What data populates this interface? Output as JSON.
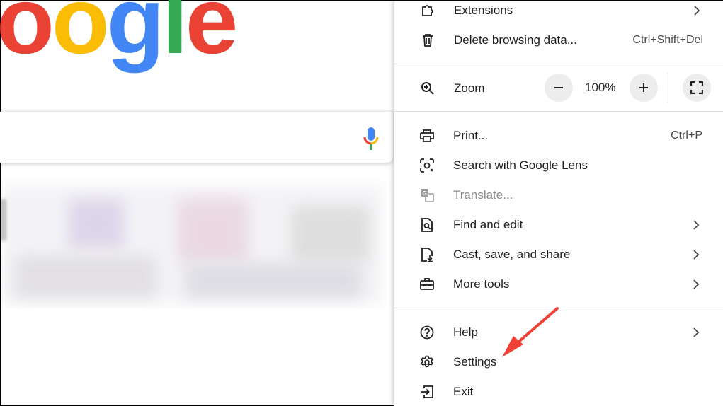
{
  "logo": {
    "letters": [
      "o",
      "o",
      "g",
      "l",
      "e"
    ],
    "colors": [
      "#EA4335",
      "#FBBC05",
      "#4285F4",
      "#34A853",
      "#EA4335"
    ]
  },
  "search": {
    "mic_icon": "microphone-icon"
  },
  "menu": {
    "extensions": {
      "label": "Extensions",
      "icon": "puzzle-icon"
    },
    "delete_browsing": {
      "label": "Delete browsing data...",
      "shortcut": "Ctrl+Shift+Del",
      "icon": "trash-icon"
    },
    "zoom": {
      "label": "Zoom",
      "value": "100%",
      "minus": "−",
      "plus": "+",
      "icon": "zoom-in-icon"
    },
    "print": {
      "label": "Print...",
      "shortcut": "Ctrl+P",
      "icon": "printer-icon"
    },
    "lens": {
      "label": "Search with Google Lens",
      "icon": "lens-icon"
    },
    "translate": {
      "label": "Translate...",
      "icon": "translate-icon",
      "disabled": true
    },
    "find_edit": {
      "label": "Find and edit",
      "icon": "find-page-icon"
    },
    "cast_save": {
      "label": "Cast, save, and share",
      "icon": "cast-save-icon"
    },
    "more_tools": {
      "label": "More tools",
      "icon": "toolbox-icon"
    },
    "help": {
      "label": "Help",
      "icon": "help-icon"
    },
    "settings": {
      "label": "Settings",
      "icon": "gear-icon"
    },
    "exit": {
      "label": "Exit",
      "icon": "exit-icon"
    }
  },
  "annotation": {
    "arrow_color": "#EF4135"
  }
}
